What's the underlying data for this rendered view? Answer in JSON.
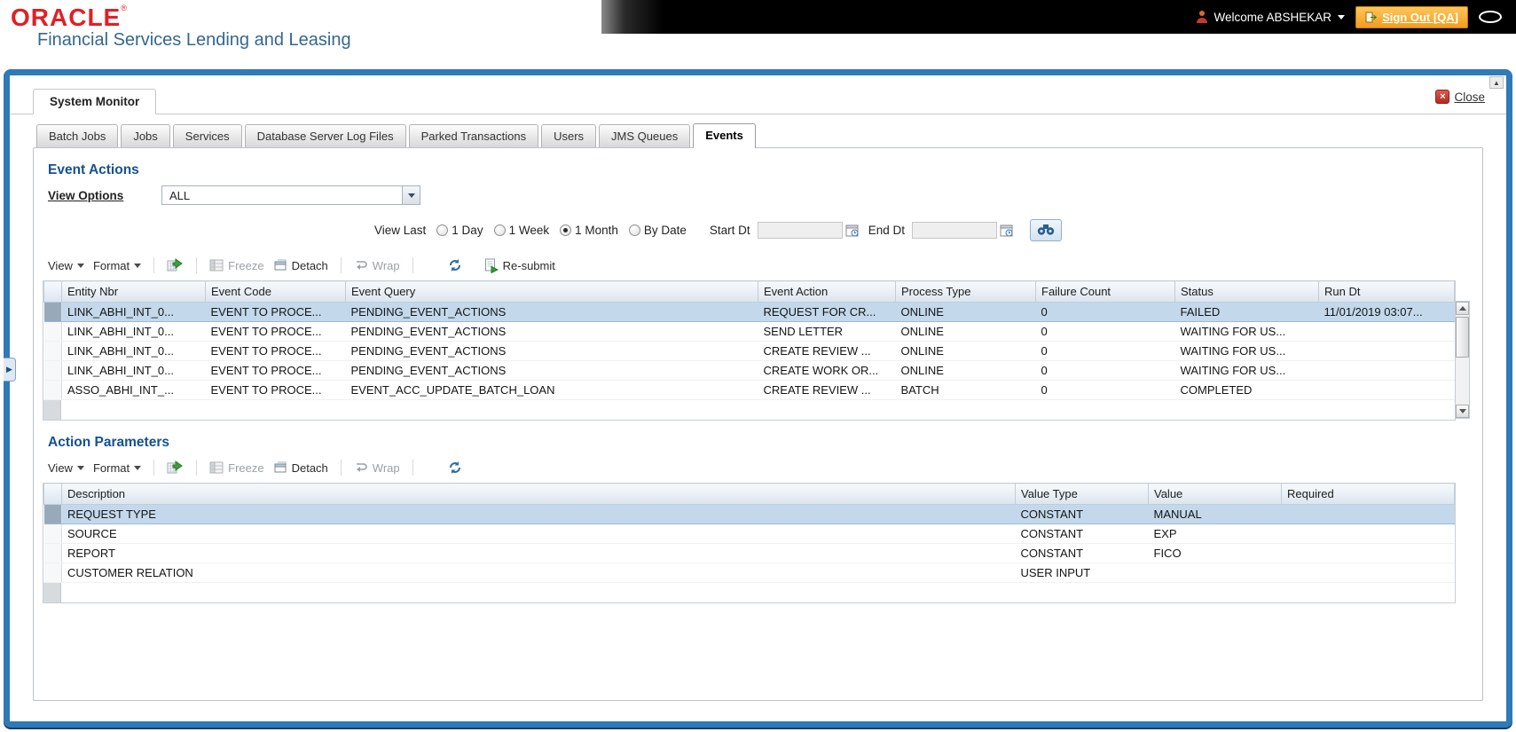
{
  "header": {
    "logo": "ORACLE",
    "logo_mark": "®",
    "subtitle": "Financial Services Lending and Leasing",
    "welcome": "Welcome ABSHEKAR",
    "sign_out": "Sign Out [QA]"
  },
  "window": {
    "title": "System Monitor",
    "close_label": "Close",
    "close_icon": "×",
    "scroll_up_icon": "▲",
    "expander_icon": "▶"
  },
  "tabs": [
    {
      "label": "Batch Jobs",
      "active": false
    },
    {
      "label": "Jobs",
      "active": false
    },
    {
      "label": "Services",
      "active": false
    },
    {
      "label": "Database Server Log Files",
      "active": false
    },
    {
      "label": "Parked Transactions",
      "active": false
    },
    {
      "label": "Users",
      "active": false
    },
    {
      "label": "JMS Queues",
      "active": false
    },
    {
      "label": "Events",
      "active": true
    }
  ],
  "toolbar": {
    "view": "View",
    "format": "Format",
    "freeze": "Freeze",
    "detach": "Detach",
    "wrap": "Wrap",
    "resubmit": "Re-submit"
  },
  "event_actions": {
    "title": "Event Actions",
    "view_options_label": "View Options",
    "view_options_value": "ALL",
    "view_last_label": "View Last",
    "radios": [
      {
        "label": "1 Day",
        "selected": false
      },
      {
        "label": "1 Week",
        "selected": false
      },
      {
        "label": "1 Month",
        "selected": true
      },
      {
        "label": "By Date",
        "selected": false
      }
    ],
    "start_dt_label": "Start Dt",
    "start_dt_value": "",
    "end_dt_label": "End Dt",
    "end_dt_value": "",
    "table": {
      "selected_row": 0,
      "columns": [
        "Entity Nbr",
        "Event Code",
        "Event Query",
        "Event Action",
        "Process Type",
        "Failure Count",
        "Status",
        "Run Dt"
      ],
      "rows": [
        [
          "LINK_ABHI_INT_0...",
          "EVENT TO PROCE...",
          "PENDING_EVENT_ACTIONS",
          "REQUEST FOR CR...",
          "ONLINE",
          "0",
          "FAILED",
          "11/01/2019 03:07..."
        ],
        [
          "LINK_ABHI_INT_0...",
          "EVENT TO PROCE...",
          "PENDING_EVENT_ACTIONS",
          "SEND LETTER",
          "ONLINE",
          "0",
          "WAITING FOR US...",
          ""
        ],
        [
          "LINK_ABHI_INT_0...",
          "EVENT TO PROCE...",
          "PENDING_EVENT_ACTIONS",
          "CREATE REVIEW ...",
          "ONLINE",
          "0",
          "WAITING FOR US...",
          ""
        ],
        [
          "LINK_ABHI_INT_0...",
          "EVENT TO PROCE...",
          "PENDING_EVENT_ACTIONS",
          "CREATE WORK OR...",
          "ONLINE",
          "0",
          "WAITING FOR US...",
          ""
        ],
        [
          "ASSO_ABHI_INT_...",
          "EVENT TO PROCE...",
          "EVENT_ACC_UPDATE_BATCH_LOAN",
          "CREATE REVIEW ...",
          "BATCH",
          "0",
          "COMPLETED",
          ""
        ]
      ]
    }
  },
  "action_parameters": {
    "title": "Action Parameters",
    "table": {
      "selected_row": 0,
      "columns": [
        "Description",
        "Value Type",
        "Value",
        "Required"
      ],
      "rows": [
        [
          "REQUEST TYPE",
          "CONSTANT",
          "MANUAL",
          ""
        ],
        [
          "SOURCE",
          "CONSTANT",
          "EXP",
          ""
        ],
        [
          "REPORT",
          "CONSTANT",
          "FICO",
          ""
        ],
        [
          "CUSTOMER RELATION",
          "USER INPUT",
          "",
          ""
        ]
      ]
    }
  }
}
